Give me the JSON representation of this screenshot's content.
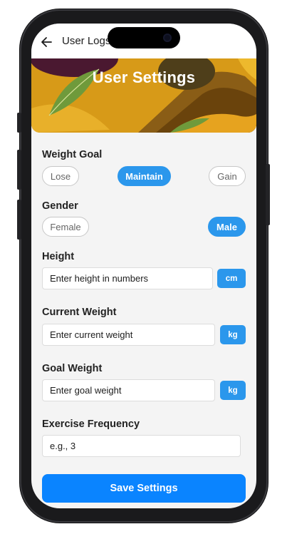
{
  "appbar": {
    "title": "User Logs",
    "back_icon": "arrow-left-icon"
  },
  "banner": {
    "title": "User Settings"
  },
  "weight_goal": {
    "label": "Weight Goal",
    "options": [
      "Lose",
      "Maintain",
      "Gain"
    ],
    "selected": "Maintain"
  },
  "gender": {
    "label": "Gender",
    "options": [
      "Female",
      "Male"
    ],
    "selected": "Male"
  },
  "height": {
    "label": "Height",
    "placeholder": "Enter height in numbers",
    "unit": "cm"
  },
  "current_weight": {
    "label": "Current Weight",
    "placeholder": "Enter current weight",
    "unit": "kg"
  },
  "goal_weight": {
    "label": "Goal Weight",
    "placeholder": "Enter goal weight",
    "unit": "kg"
  },
  "exercise_frequency": {
    "label": "Exercise Frequency",
    "placeholder": "e.g., 3"
  },
  "save_button": {
    "label": "Save Settings"
  },
  "colors": {
    "accent": "#2b97ec",
    "primary_button": "#0a84ff",
    "banner": "#d79a18"
  }
}
